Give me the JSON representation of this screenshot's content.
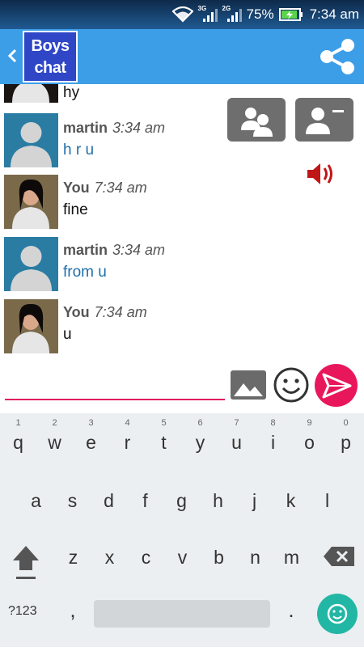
{
  "status_bar": {
    "net1": "3G",
    "net2": "2G",
    "battery_percent": "75%",
    "time": "7:34 am",
    "icons": [
      "wifi-icon",
      "signal-icon",
      "signal-icon",
      "battery-charging-icon"
    ]
  },
  "app_bar": {
    "logo_line1": "Boys",
    "logo_line2": "chat",
    "back_icon": "chevron-left-icon",
    "share_icon": "share-icon"
  },
  "messages": [
    {
      "sender": "",
      "time": "",
      "text": "hy",
      "avatar": "you"
    },
    {
      "sender": "martin",
      "time": "3:34 am",
      "text": "h r u",
      "avatar": "martin"
    },
    {
      "sender": "You",
      "time": "7:34 am",
      "text": "fine",
      "avatar": "you"
    },
    {
      "sender": "martin",
      "time": "3:34 am",
      "text": "from u",
      "avatar": "martin"
    },
    {
      "sender": "You",
      "time": "7:34 am",
      "text": "u",
      "avatar": "you"
    }
  ],
  "actions": {
    "group_icon": "group-users-icon",
    "remove_icon": "remove-contact-icon",
    "speaker_icon": "speaker-icon"
  },
  "compose": {
    "value": "",
    "gallery_icon": "image-gallery-icon",
    "emoji_icon": "smiley-icon",
    "send_icon": "send-icon"
  },
  "keyboard": {
    "row1": [
      {
        "hint": "1",
        "ch": "q"
      },
      {
        "hint": "2",
        "ch": "w"
      },
      {
        "hint": "3",
        "ch": "e"
      },
      {
        "hint": "4",
        "ch": "r"
      },
      {
        "hint": "5",
        "ch": "t"
      },
      {
        "hint": "6",
        "ch": "y"
      },
      {
        "hint": "7",
        "ch": "u"
      },
      {
        "hint": "8",
        "ch": "i"
      },
      {
        "hint": "9",
        "ch": "o"
      },
      {
        "hint": "0",
        "ch": "p"
      }
    ],
    "row2": [
      "a",
      "s",
      "d",
      "f",
      "g",
      "h",
      "j",
      "k",
      "l"
    ],
    "row3": [
      "z",
      "x",
      "c",
      "v",
      "b",
      "n",
      "m"
    ],
    "symbols_label": "?123",
    "comma": ",",
    "period": ".",
    "colors": {
      "accent": "#e8175c",
      "emoji_key": "#22b7a5",
      "app_bar": "#3d9ee8"
    }
  }
}
